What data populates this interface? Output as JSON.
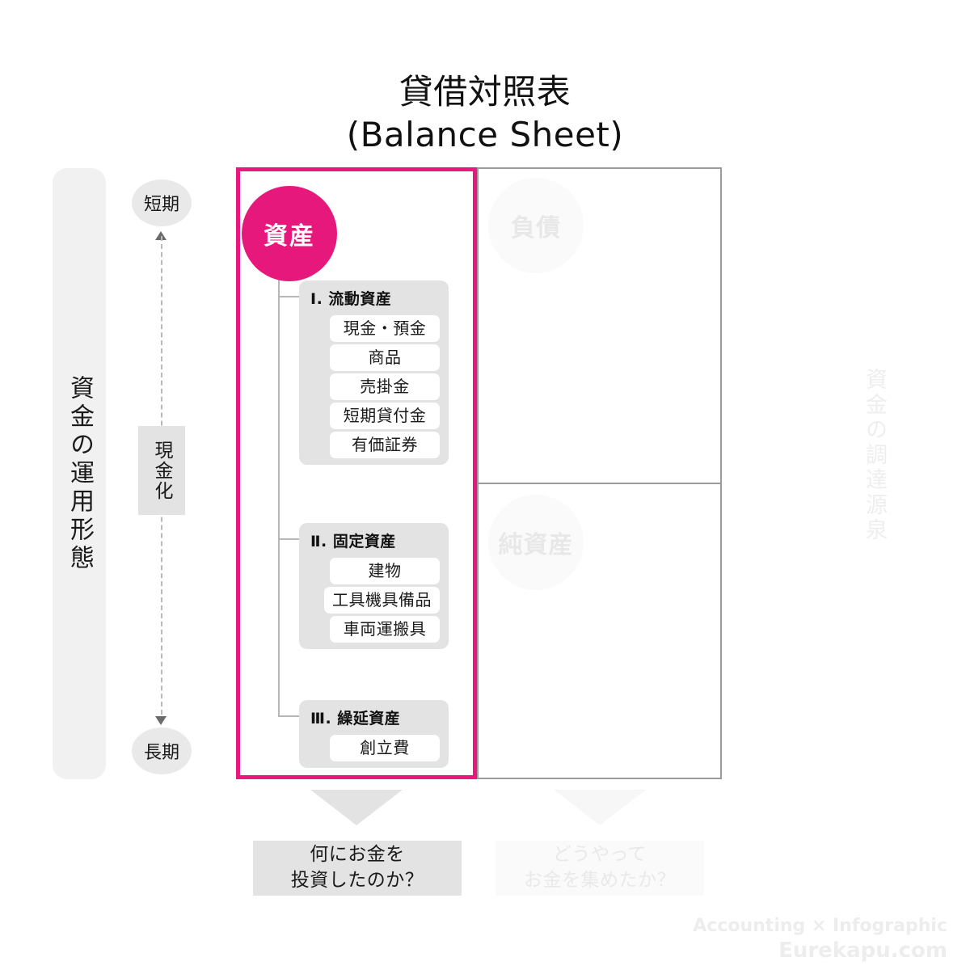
{
  "title": {
    "line1": "貸借対照表",
    "line2": "(Balance Sheet)"
  },
  "left_axis": {
    "bar_label": "資金の運用形態",
    "top_badge": "短期",
    "bottom_badge": "長期",
    "middle_label": "現金化"
  },
  "right_axis": {
    "bar_label": "資金の調達源泉"
  },
  "assets": {
    "circle_label": "資産",
    "accent_color": "#e6187c",
    "groups": [
      {
        "title": "Ⅰ. 流動資産",
        "items": [
          "現金・預金",
          "商品",
          "売掛金",
          "短期貸付金",
          "有価証券"
        ]
      },
      {
        "title": "Ⅱ. 固定資産",
        "items": [
          "建物",
          "工具機具備品",
          "車両運搬具"
        ]
      },
      {
        "title": "Ⅲ. 繰延資産",
        "items": [
          "創立費"
        ]
      }
    ]
  },
  "right_side": {
    "liabilities_label": "負債",
    "net_assets_label": "純資産"
  },
  "captions": {
    "left_line1": "何にお金を",
    "left_line2": "投資したのか？",
    "right_line1": "どうやって",
    "right_line2": "お金を集めたか？"
  },
  "footer": {
    "line1": "Accounting × Infographic",
    "line2": "Eurekapu.com"
  }
}
